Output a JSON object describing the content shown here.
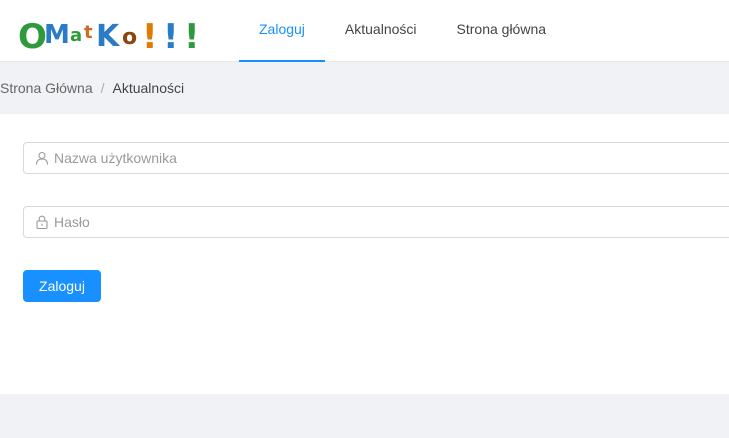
{
  "logo": {
    "text": "OMatKo!!!"
  },
  "nav": {
    "items": [
      {
        "label": "Zaloguj",
        "active": true
      },
      {
        "label": "Aktualności",
        "active": false
      },
      {
        "label": "Strona główna",
        "active": false
      }
    ]
  },
  "breadcrumb": {
    "home": "Strona Główna",
    "separator": "/",
    "current": "Aktualności"
  },
  "login_form": {
    "username_placeholder": "Nazwa użytkownika",
    "username_icon": "user-icon",
    "password_placeholder": "Hasło",
    "password_icon": "lock-icon",
    "submit_label": "Zaloguj"
  },
  "colors": {
    "accent": "#1890ff",
    "background": "#f0f2f5"
  }
}
